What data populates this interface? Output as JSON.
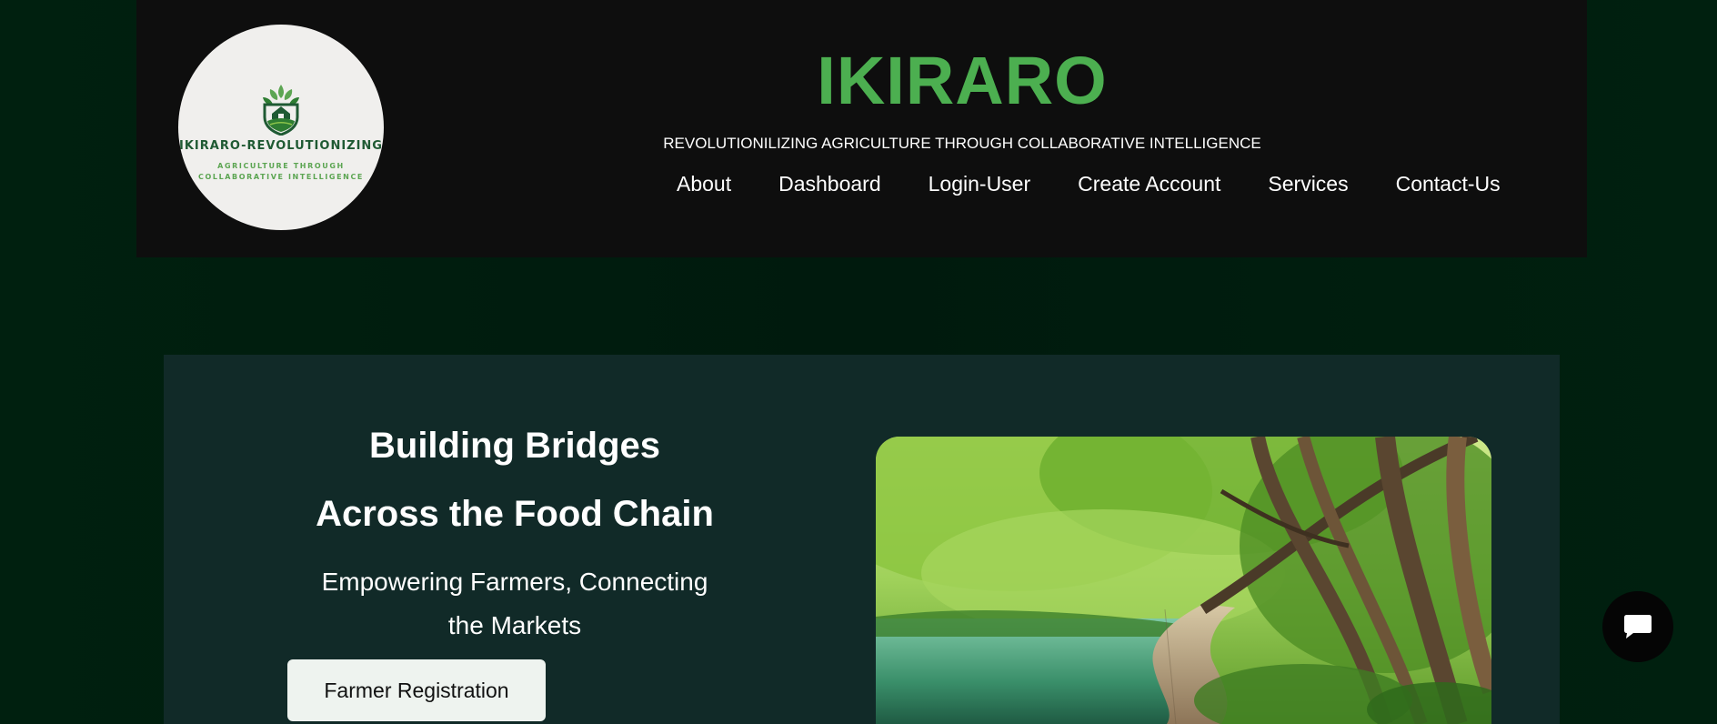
{
  "logo": {
    "line1": "IKIRARO-REVOLUTIONIZING",
    "line2": "AGRICULTURE THROUGH",
    "line3": "COLLABORATIVE INTELLIGENCE",
    "icon": "leaf-house-shield-icon"
  },
  "header": {
    "title": "IKIRARO",
    "tagline": "REVOLUTIONILIZING AGRICULTURE THROUGH COLLABORATIVE INTELLIGENCE",
    "nav": [
      "About",
      "Dashboard",
      "Login-User",
      "Create Account",
      "Services",
      "Contact-Us"
    ]
  },
  "hero": {
    "heading_line1": "Building Bridges",
    "heading_line2": "Across the Food Chain",
    "subheading": "Empowering Farmers, Connecting the Markets",
    "button_label": "Farmer Registration",
    "image": "forest-boardwalk-lake-photo"
  },
  "chat": {
    "icon": "chat-bubble-icon"
  },
  "colors": {
    "brand_green": "#4caf50",
    "page_bg": "#001a0e",
    "header_bg": "#0e0e0e",
    "hero_bg": "#112a28"
  }
}
